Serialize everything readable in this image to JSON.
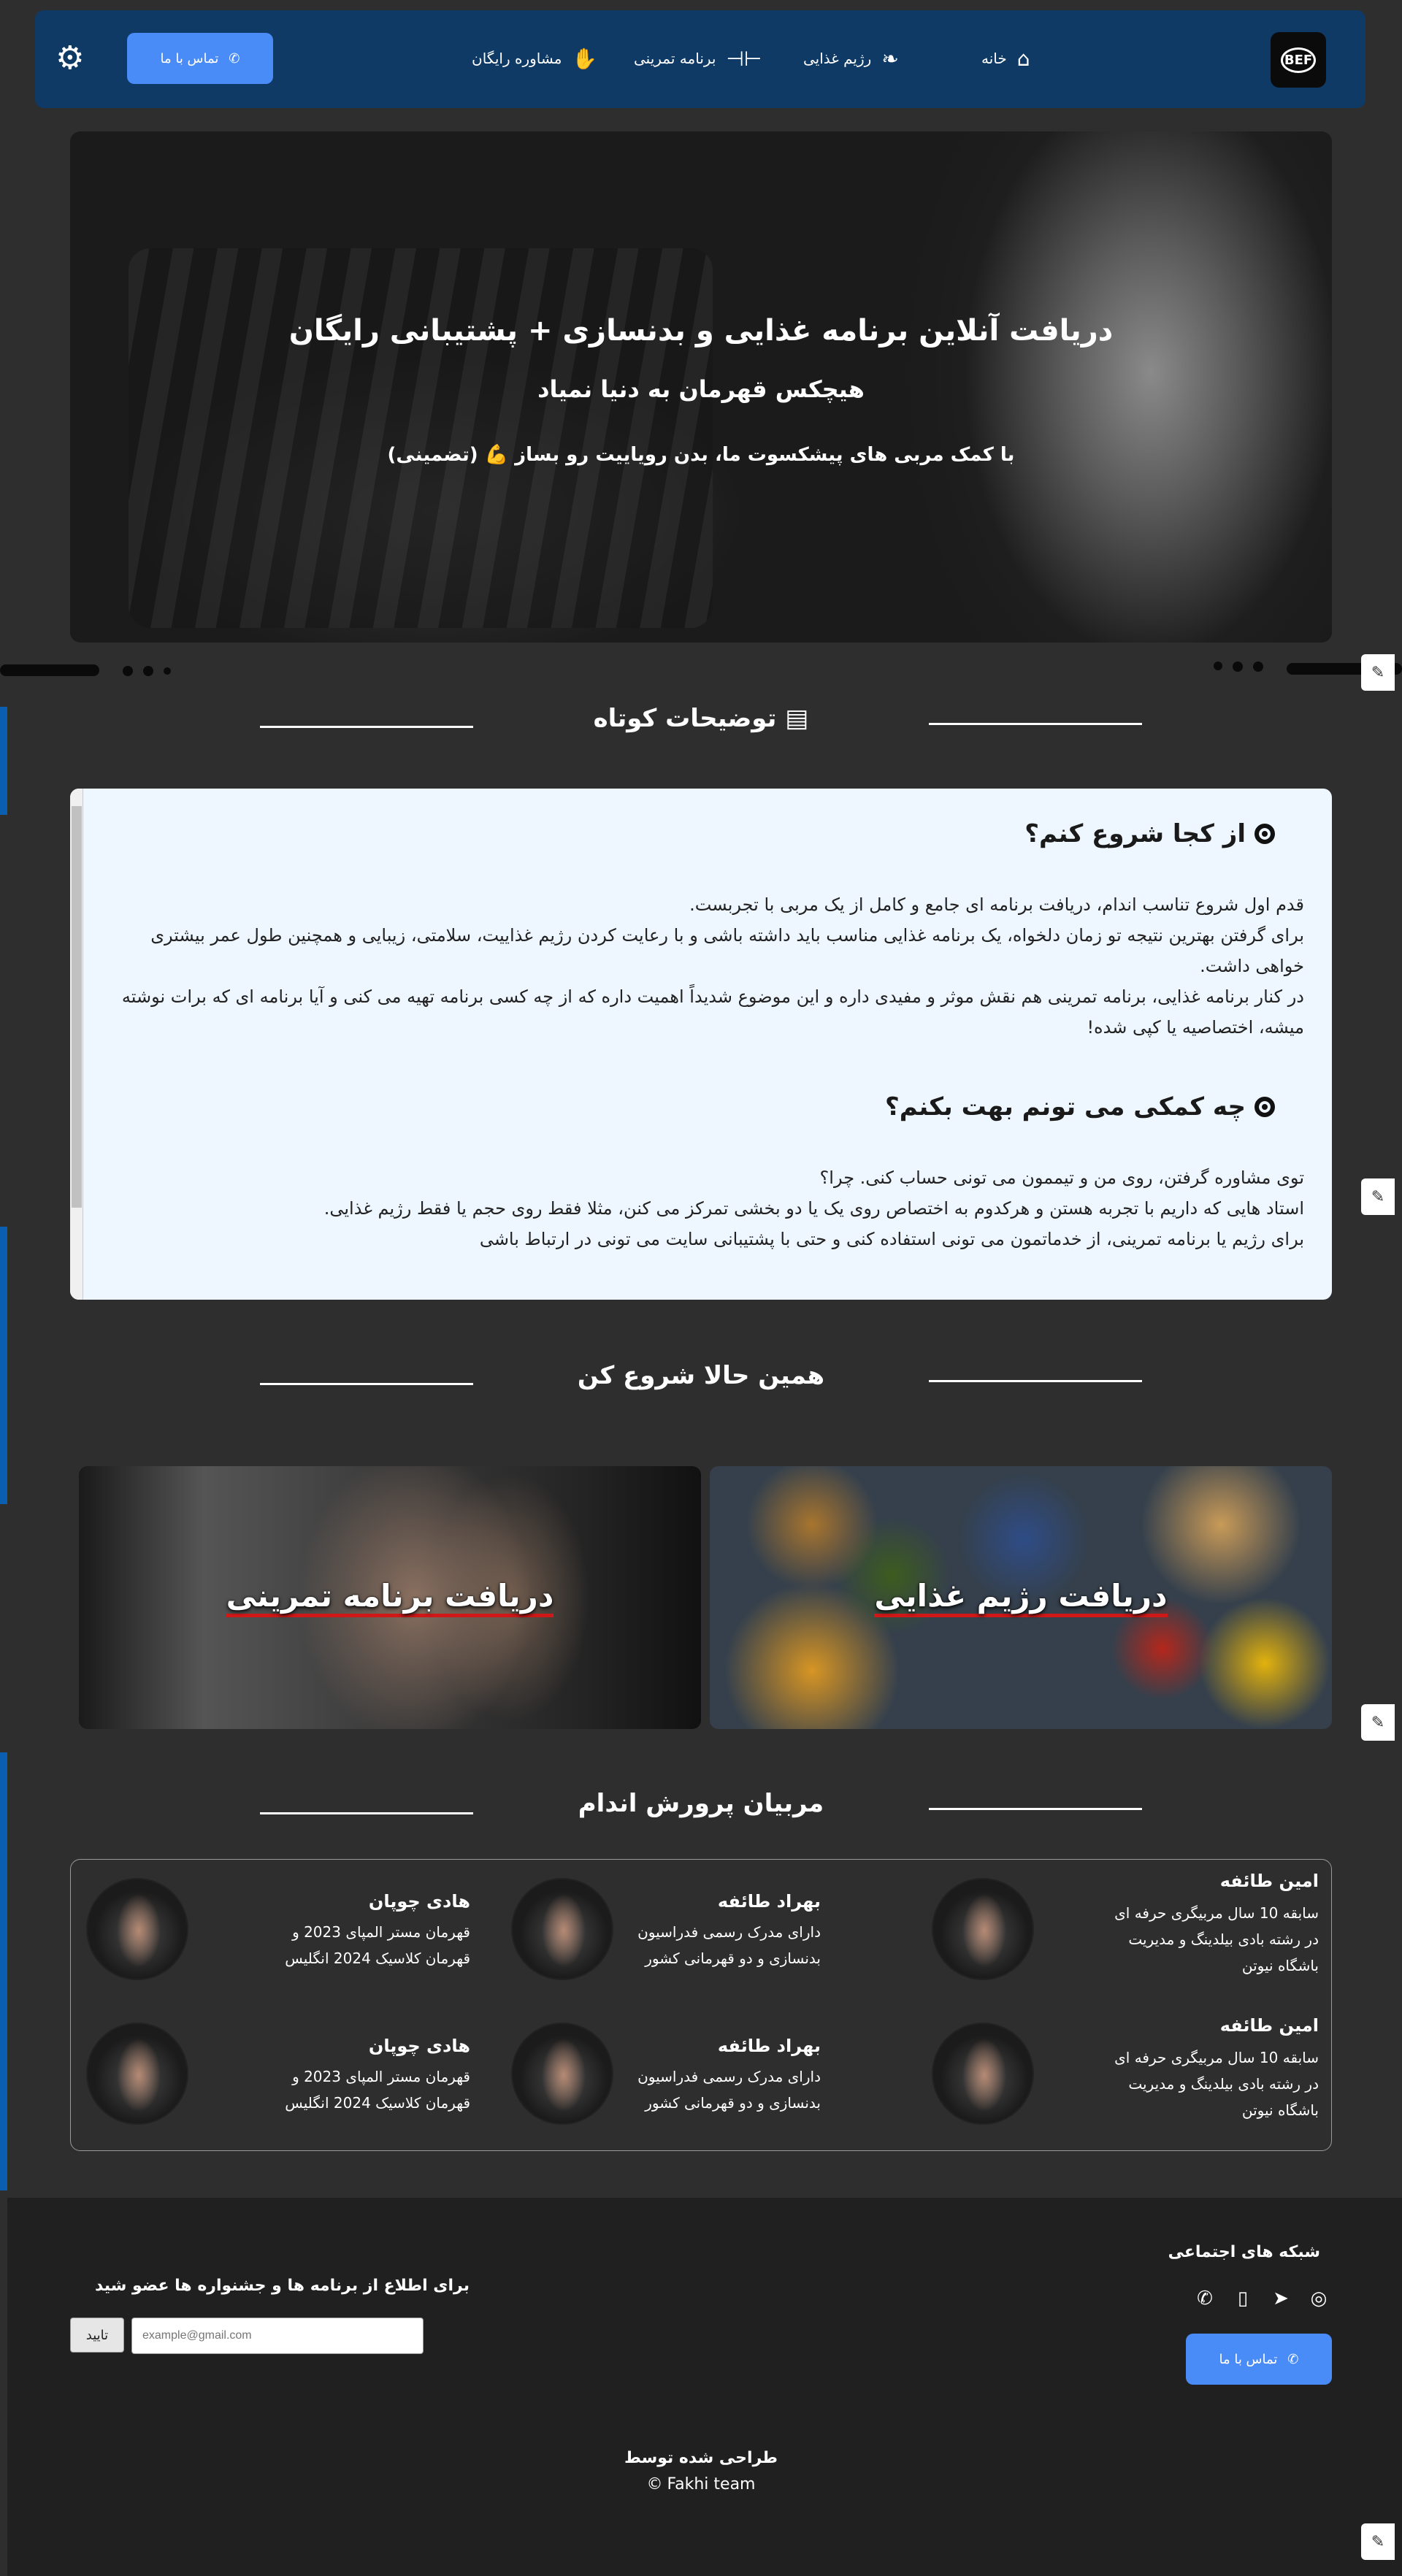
{
  "nav": {
    "logo_text": "BEF",
    "items": [
      {
        "label": "خانه",
        "icon": "home-icon"
      },
      {
        "label": "رژیم غذایی",
        "icon": "leaf-icon"
      },
      {
        "label": "برنامه تمرینی",
        "icon": "dumbbell-icon"
      },
      {
        "label": "مشاوره رایگان",
        "icon": "handshake-icon"
      }
    ],
    "contact_label": "تماس با ما"
  },
  "hero": {
    "title": "دریافت آنلاین برنامه غذایی و بدنسازی + پشتیبانی رایگان",
    "subtitle": "هیچکس قهرمان به دنیا نمیاد",
    "line": "با کمک مربی های پیشکسوت ما، بدن رویاییت رو بساز 💪 (تضمینی)"
  },
  "summary": {
    "title": "توضیحات کوتاه",
    "q1_title": "از کجا شروع کنم؟",
    "q1_p1": "قدم اول شروع تناسب اندام، دریافت برنامه ای جامع و کامل از یک مربی با تجربست.",
    "q1_p2": "برای گرفتن بهترین نتیجه تو زمان دلخواه، یک برنامه غذایی مناسب باید داشته باشی و با رعایت کردن رژیم غذاییت، سلامتی، زیبایی و همچنین طول عمر بیشتری خواهی داشت.",
    "q1_p3": "در کنار برنامه غذایی، برنامه تمرینی هم نقش موثر و مفیدی داره و این موضوع شدیداً اهمیت داره که از چه کسی برنامه تهیه می کنی و آیا برنامه ای که برات نوشته میشه، اختصاصیه یا کپی شده!",
    "q2_title": "چه کمکی می تونم بهت بکنم؟",
    "q2_p1": "توی مشاوره گرفتن، روی من و تیممون می تونی حساب کنی. چرا؟",
    "q2_p2": "استاد هایی که داریم با تجربه هستن و هرکدوم به اختصاص روی یک یا دو بخشی تمرکز می کنن، مثلا فقط روی حجم یا فقط رژیم غذایی.",
    "q2_p3": "برای رژیم یا برنامه تمرینی، از خدماتمون می تونی استفاده کنی و حتی با پشتیبانی سایت می تونی در ارتباط باشی"
  },
  "start": {
    "title": "همین حالا شروع کن",
    "diet_label": "دریافت رژیم غذایی",
    "train_label": "دریافت برنامه تمرینی"
  },
  "trainers": {
    "title": "مربیان پرورش اندام",
    "list": [
      {
        "name": "امین طائفه",
        "desc": "سابقه 10 سال مربیگری حرفه ای در رشته بادی بیلدینگ و مدیریت باشگاه نیوتن"
      },
      {
        "name": "بهراد طائفه",
        "desc": "دارای مدرک رسمی فدراسیون بدنسازی و دو قهرمانی کشور"
      },
      {
        "name": "هادی چوپان",
        "desc": "قهرمان مستر المپای 2023 و قهرمان کلاسیک 2024 انگلیس"
      },
      {
        "name": "امین طائفه",
        "desc": "سابقه 10 سال مربیگری حرفه ای در رشته بادی بیلدینگ و مدیریت باشگاه نیوتن"
      },
      {
        "name": "بهراد طائفه",
        "desc": "دارای مدرک رسمی فدراسیون بدنسازی و دو قهرمانی کشور"
      },
      {
        "name": "هادی چوپان",
        "desc": "قهرمان مستر المپای 2023 و قهرمان کلاسیک 2024 انگلیس"
      }
    ]
  },
  "footer": {
    "social_title": "شبکه های اجتماعی",
    "social_icons": [
      "instagram-icon",
      "telegram-icon",
      "phone-icon",
      "whatsapp-icon"
    ],
    "contact_label": "تماس با ما",
    "newsletter_title": "برای اطلاع از برنامه ها و جشنواره ها عضو شید",
    "email_placeholder": "example@gmail.com",
    "submit_label": "تایید",
    "designed_by": "طراحی شده توسط",
    "credit": "Fakhi team",
    "copyright_symbol": "©"
  },
  "colors": {
    "nav_bg": "#0f3a66",
    "accent": "#4a8cf7",
    "page_bg": "#2e2e2e",
    "card_underline": "#d01818"
  }
}
